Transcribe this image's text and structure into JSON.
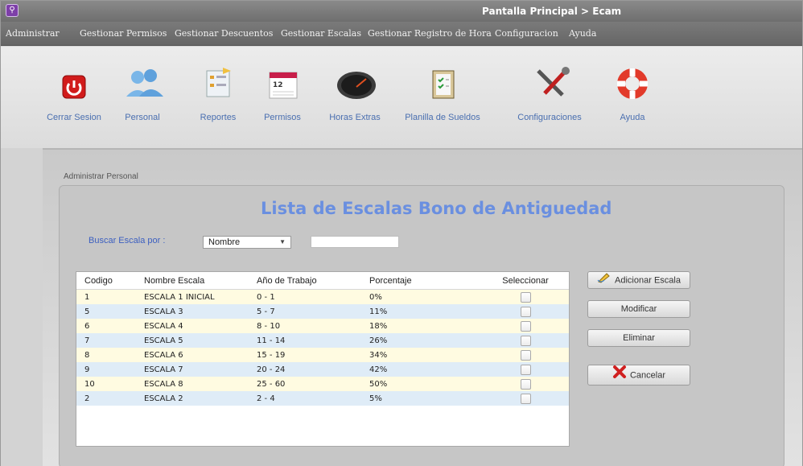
{
  "window": {
    "title": "Pantalla Principal > Ecam",
    "app_icon": "app-logo-icon"
  },
  "menu": [
    "Administrar",
    "Gestionar Permisos",
    "Gestionar Descuentos",
    "Gestionar Escalas",
    "Gestionar Registro de Hora",
    "Configuracion",
    "Ayuda"
  ],
  "toolbar": {
    "items": [
      {
        "label": "Cerrar Sesion",
        "icon": "power-icon"
      },
      {
        "label": "Personal",
        "icon": "people-icon"
      },
      {
        "label": "Reportes",
        "icon": "reports-icon"
      },
      {
        "label": "Permisos",
        "icon": "calendar-icon"
      },
      {
        "label": "Horas Extras",
        "icon": "speedometer-icon"
      },
      {
        "label": "Planilla de Sueldos",
        "icon": "clipboard-icon"
      },
      {
        "label": "Configuraciones",
        "icon": "tools-icon"
      },
      {
        "label": "Ayuda",
        "icon": "lifebuoy-icon"
      }
    ]
  },
  "panel": {
    "title": "Administrar Personal",
    "heading": "Lista de Escalas Bono de Antiguedad",
    "search": {
      "label": "Buscar Escala por :",
      "selected": "Nombre",
      "value": ""
    }
  },
  "table": {
    "columns": [
      "Codigo",
      "Nombre Escala",
      "Año de Trabajo",
      "Porcentaje",
      "Seleccionar"
    ],
    "rows": [
      {
        "codigo": "1",
        "nombre": "ESCALA 1 INICIAL",
        "anio": "0 - 1",
        "porcentaje": "0%"
      },
      {
        "codigo": "5",
        "nombre": "ESCALA 3",
        "anio": "5 - 7",
        "porcentaje": "11%"
      },
      {
        "codigo": "6",
        "nombre": "ESCALA 4",
        "anio": "8 - 10",
        "porcentaje": "18%"
      },
      {
        "codigo": "7",
        "nombre": "ESCALA 5",
        "anio": "11 - 14",
        "porcentaje": "26%"
      },
      {
        "codigo": "8",
        "nombre": "ESCALA 6",
        "anio": "15 - 19",
        "porcentaje": "34%"
      },
      {
        "codigo": "9",
        "nombre": "ESCALA 7",
        "anio": "20 - 24",
        "porcentaje": "42%"
      },
      {
        "codigo": "10",
        "nombre": "ESCALA 8",
        "anio": "25 - 60",
        "porcentaje": "50%"
      },
      {
        "codigo": "2",
        "nombre": "ESCALA 2",
        "anio": "2 - 4",
        "porcentaje": "5%"
      }
    ]
  },
  "buttons": {
    "add": "Adicionar Escala",
    "modify": "Modificar",
    "delete": "Eliminar",
    "cancel": "Cancelar"
  },
  "colors": {
    "link_blue": "#4a6fb0",
    "heading_blue": "#6a8fe0",
    "row_yellow": "#fffbe1",
    "row_blue": "#dfecf7"
  }
}
